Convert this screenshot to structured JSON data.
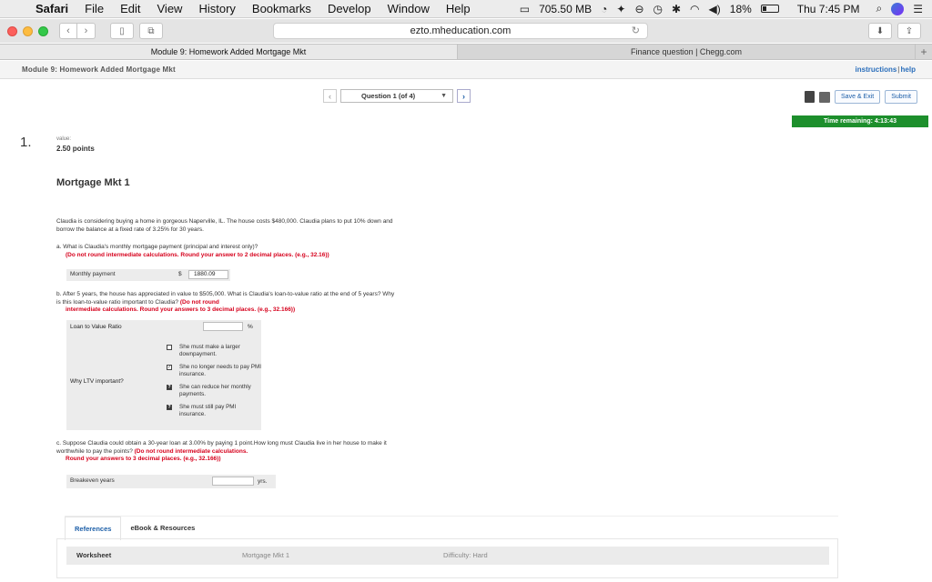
{
  "menubar": {
    "app": "Safari",
    "menus": [
      "File",
      "Edit",
      "View",
      "History",
      "Bookmarks",
      "Develop",
      "Window",
      "Help"
    ],
    "storage": "705.50 MB",
    "battery": "18%",
    "clock": "Thu 7:45 PM"
  },
  "browser": {
    "url": "ezto.mheducation.com",
    "tabs": [
      {
        "title": "Module 9: Homework Added Mortgage Mkt",
        "active": true
      },
      {
        "title": "Finance question | Chegg.com",
        "active": false
      }
    ]
  },
  "page": {
    "header_title": "Module 9: Homework Added Mortgage Mkt",
    "instructions_link": "instructions",
    "help_link": "help",
    "link_separator": "|",
    "question_selector": "Question 1 (of 4)",
    "save_exit": "Save & Exit",
    "submit": "Submit",
    "timer": "Time remaining: 4:13:43"
  },
  "question": {
    "number": "1.",
    "value_label": "value:",
    "points": "2.50 points",
    "title": "Mortgage Mkt 1",
    "intro": "Claudia is considering buying a home in gorgeous Naperville, IL.  The house costs $480,000.  Claudia plans to put 10% down and borrow the balance at a fixed rate of 3.25% for 30 years.",
    "part_a": {
      "text": "a.  What is Claudia's monthly mortgage payment (principal and interest only)?",
      "instruction": "(Do not round intermediate calculations. Round your answer to 2 decimal places. (e.g., 32.16))",
      "row_label": "Monthly payment",
      "currency": "$",
      "value": "1880.09"
    },
    "part_b": {
      "text": "b.  After 5 years, the house has appreciated in value to $505,000.  What is Claudia's loan-to-value ratio at the end of 5 years?  Why is this loan-to-value ratio important to Claudia?",
      "instruction_inline": "(Do not round",
      "instruction_rest": "intermediate calculations. Round your answers to 3 decimal places. (e.g., 32.166))",
      "ltv_label": "Loan to Value Ratio",
      "ltv_unit": "%",
      "why_label": "Why LTV important?",
      "choices": [
        {
          "text": "She must make a larger downpayment.",
          "state": "unchecked",
          "mark": ""
        },
        {
          "text": "She no longer needs to pay PMI insurance.",
          "state": "checked",
          "mark": "✓"
        },
        {
          "text": "She can reduce her monthly payments.",
          "state": "unknown",
          "mark": "?"
        },
        {
          "text": "She must still pay PMI insurance.",
          "state": "unknown",
          "mark": "?"
        }
      ]
    },
    "part_c": {
      "text": "c.  Suppose Claudia could obtain a 30-year loan at 3.00% by paying 1 point.How long must Claudia live in her house to make it worthwhile to pay the points?",
      "instruction_inline": "(Do not round intermediate calculations.",
      "instruction_rest": "Round your answers to 3 decimal places. (e.g., 32.166))",
      "row_label": "Breakeven years",
      "unit": "yrs."
    }
  },
  "references": {
    "tabs": [
      "References",
      "eBook & Resources"
    ],
    "worksheet_label": "Worksheet",
    "worksheet_title": "Mortgage Mkt 1",
    "difficulty": "Difficulty: Hard"
  }
}
